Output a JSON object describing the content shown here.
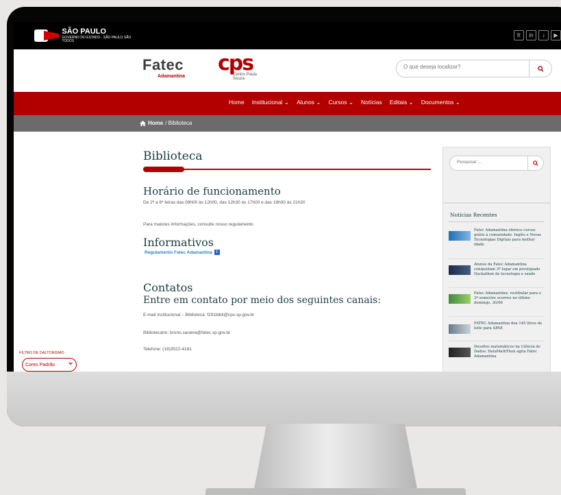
{
  "gov": {
    "title": "SÃO PAULO",
    "subtitle": "GOVERNO DO ESTADO · SÃO PAULO SÃO TODOS"
  },
  "social": [
    "fr",
    "in",
    "♪",
    "▶"
  ],
  "header": {
    "fatec_name": "Fatec",
    "fatec_unit": "Adamantina",
    "cps_mark": "cps",
    "cps_sub": "Centro Paula Souza",
    "search_placeholder": "O que deseja localizar?"
  },
  "nav": {
    "items": [
      "Home",
      "Institucional ⌄",
      "Alunos ⌄",
      "Cursos ⌄",
      "Notícias",
      "Editais ⌄",
      "Documentos ⌄"
    ]
  },
  "breadcrumb": {
    "home": "Home",
    "current": " / Biblioteca"
  },
  "page": {
    "title": "Biblioteca",
    "hours_title": "Horário de funcionamento",
    "hours_text": "De 2ª a 6ª feiras das 08h00 às 12h00, das 12h30 às 17h00 e das 18h00 às 21h30",
    "info_text": "Para maiores informações, consulte nosso regulamento",
    "informativos_title": "Informativos",
    "regulamento_link": "Regulamento Fatec Adamantina",
    "contatos_title": "Contatos",
    "contatos_sub": "Entre em contato por meio dos seguintes canais:",
    "email_text": "E-mail institucional – Biblioteca: f291bibli@cps.sp.gov.br",
    "bibliotecario_text": "Bibliotecário: bruno.saraiva@fatec.sp.gov.br",
    "telefone_text": "Telefone: (18)3522-4181"
  },
  "filter": {
    "label": "FILTRO DE DALTONISMO",
    "value": "Cores Padrão"
  },
  "sidebar": {
    "search_placeholder": "Pesquisar ...",
    "recent_title": "Notícias Recentes",
    "news": [
      "Fatec Adamantina oferece cursos grátis à comunidade: Inglês e Novas Tecnologias Digitais para melhor idade",
      "Alunos da Fatec Adamantina conquistam 3º lugar em prestigiado Hackathon de tecnologia e saúde",
      "Fatec Adamantina: vestibular para o 2º semestre ocorreu no último domingo, 30/06",
      "FATEC Adamantina doa 145 litros de leite para APAE",
      "Desafios matemáticos na Ciência de Dados: DataMathThon agita Fatec Adamantina"
    ]
  },
  "colors": {
    "brand_red": "#b20000",
    "breadcrumb_gray": "#6b6b6b",
    "heading": "#1a3a3a"
  }
}
